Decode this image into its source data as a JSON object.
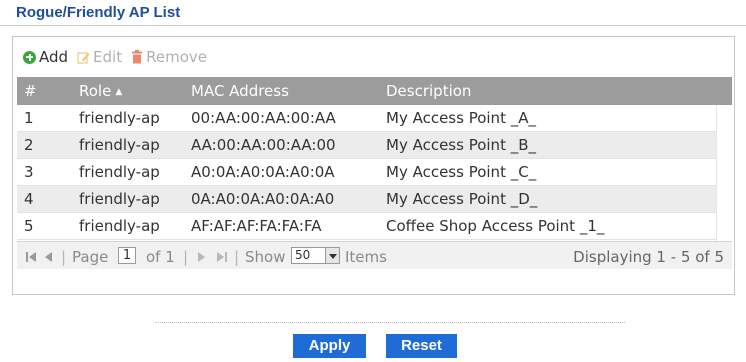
{
  "page": {
    "title": "Rogue/Friendly AP List"
  },
  "toolbar": {
    "add_label": "Add",
    "edit_label": "Edit",
    "remove_label": "Remove"
  },
  "table": {
    "headers": {
      "num": "#",
      "role": "Role",
      "mac": "MAC Address",
      "description": "Description"
    },
    "sort_indicator": "▲",
    "rows": [
      {
        "num": "1",
        "role": "friendly-ap",
        "mac": "00:AA:00:AA:00:AA",
        "description": "My Access Point _A_"
      },
      {
        "num": "2",
        "role": "friendly-ap",
        "mac": "AA:00:AA:00:AA:00",
        "description": "My Access Point _B_"
      },
      {
        "num": "3",
        "role": "friendly-ap",
        "mac": "A0:0A:A0:0A:A0:0A",
        "description": "My Access Point _C_"
      },
      {
        "num": "4",
        "role": "friendly-ap",
        "mac": "0A:A0:0A:A0:0A:A0",
        "description": "My Access Point _D_"
      },
      {
        "num": "5",
        "role": "friendly-ap",
        "mac": "AF:AF:AF:FA:FA:FA",
        "description": "Coffee Shop Access Point _1_"
      }
    ]
  },
  "pager": {
    "page_label": "Page",
    "page_value": "1",
    "of_label": "of 1",
    "show_label": "Show",
    "show_value": "50",
    "items_label": "Items",
    "displaying": "Displaying 1 - 5 of 5"
  },
  "buttons": {
    "apply": "Apply",
    "reset": "Reset"
  },
  "colors": {
    "title": "#1f4e9b",
    "header_bg": "#9c9c9c",
    "button_bg": "#1f6cd6",
    "add_icon": "#3aa63a",
    "remove_icon": "#e05a2a",
    "edit_icon": "#f0b840"
  },
  "icons": {
    "add": "plus-circle-icon",
    "edit": "pencil-icon",
    "remove": "trash-icon"
  }
}
